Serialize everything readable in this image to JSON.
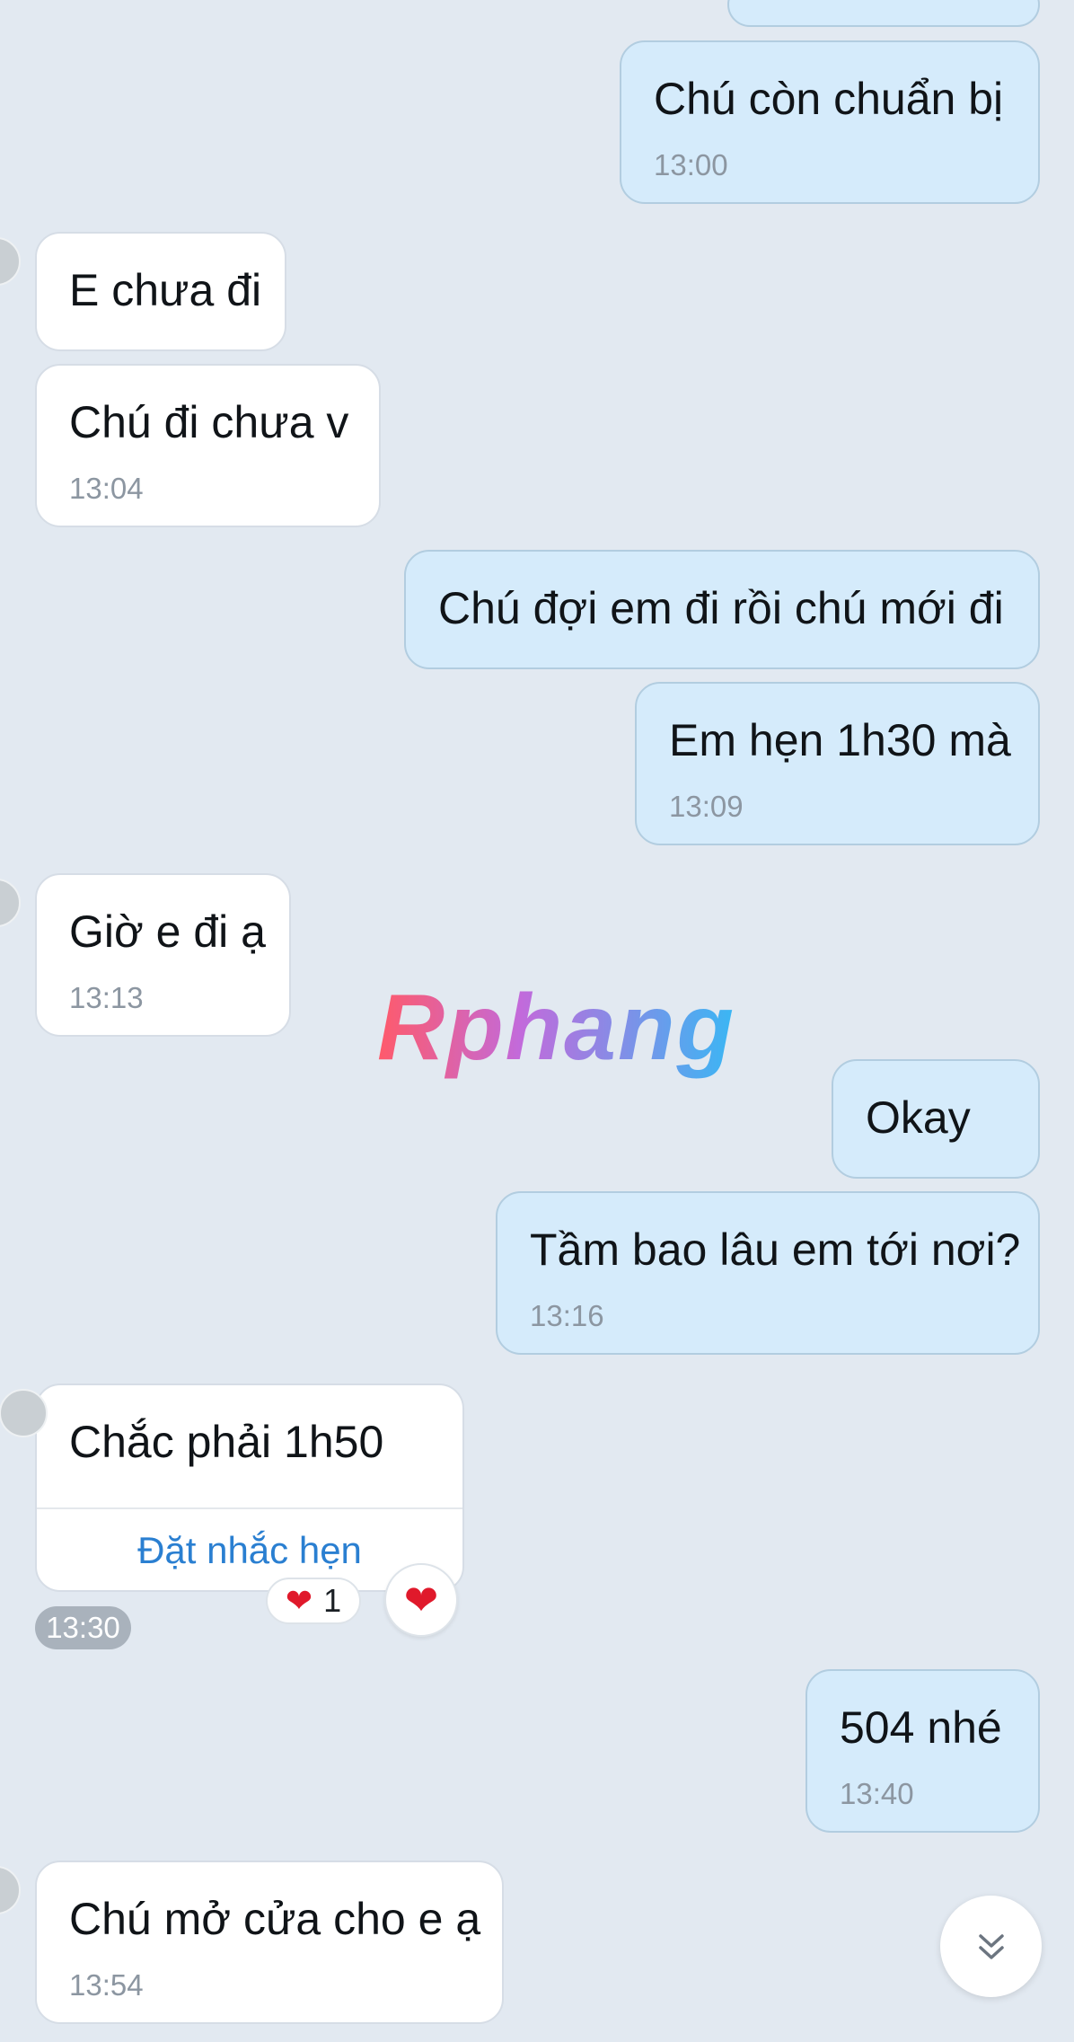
{
  "messages": [
    {
      "side": "sent",
      "text": "",
      "time": ""
    },
    {
      "side": "sent",
      "text": "Chú còn chuẩn bị",
      "time": "13:00"
    },
    {
      "side": "received",
      "text": "E chưa đi",
      "time": ""
    },
    {
      "side": "received",
      "text": "Chú đi chưa v",
      "time": "13:04"
    },
    {
      "side": "sent",
      "text": "Chú đợi em đi rồi chú mới đi",
      "time": ""
    },
    {
      "side": "sent",
      "text": "Em hẹn 1h30 mà",
      "time": "13:09"
    },
    {
      "side": "received",
      "text": "Giờ e đi ạ",
      "time": "13:13"
    },
    {
      "side": "sent",
      "text": "Okay",
      "time": ""
    },
    {
      "side": "sent",
      "text": "Tầm bao lâu em tới nơi?",
      "time": "13:16"
    },
    {
      "side": "received",
      "text": "Chắc phải 1h50",
      "time": "13:30",
      "action": "Đặt nhắc hẹn",
      "reaction_count": "1"
    },
    {
      "side": "sent",
      "text": "504 nhé",
      "time": "13:40"
    },
    {
      "side": "received",
      "text": "Chú mở cửa cho e ạ",
      "time": "13:54"
    }
  ],
  "watermark": "Rphang",
  "icons": {
    "reaction": "heart-icon",
    "scroll": "double-chevron-down-icon"
  },
  "colors": {
    "background": "#e2e9f1",
    "sent_bubble": "#d5ebfb",
    "received_bubble": "#ffffff",
    "link": "#2a7fd1",
    "heart": "#e0192b"
  }
}
